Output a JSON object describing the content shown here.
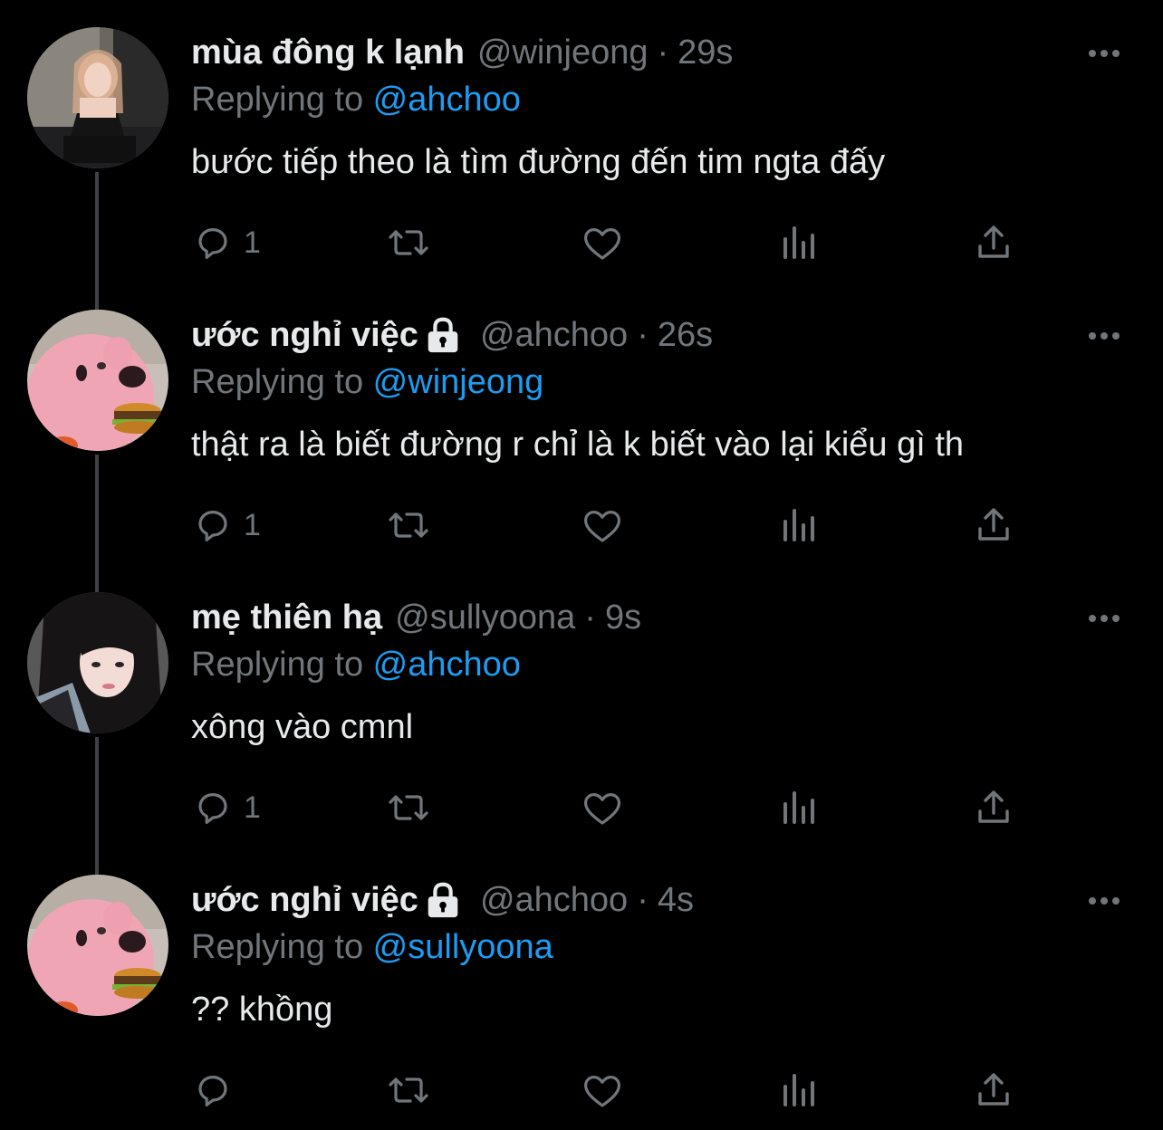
{
  "colors": {
    "background": "#000000",
    "text_primary": "#e7e9ea",
    "text_secondary": "#71767b",
    "link": "#1d9bf0",
    "thread_line": "#3e4144"
  },
  "ui": {
    "replying_prefix": "Replying to",
    "dot": "·"
  },
  "tweets": [
    {
      "display_name": "mùa đông k lạnh",
      "locked": false,
      "handle": "@winjeong",
      "time": "29s",
      "reply_to": "@ahchoo",
      "text": "bước tiếp theo là tìm đường đến tim ngta đấy",
      "reply_count": "1",
      "avatar_icon": "girl-photo-avatar"
    },
    {
      "display_name": "ước nghỉ việc",
      "locked": true,
      "handle": "@ahchoo",
      "time": "26s",
      "reply_to": "@winjeong",
      "text": "thật ra là biết đường r chỉ là k biết vào lại kiểu gì th",
      "reply_count": "1",
      "avatar_icon": "pink-beaver-burger-avatar"
    },
    {
      "display_name": "mẹ thiên hạ",
      "locked": false,
      "handle": "@sullyoona",
      "time": "9s",
      "reply_to": "@ahchoo",
      "text": "xông vào cmnl",
      "reply_count": "1",
      "avatar_icon": "girl-selfie-avatar"
    },
    {
      "display_name": "ước nghỉ việc",
      "locked": true,
      "handle": "@ahchoo",
      "time": "4s",
      "reply_to": "@sullyoona",
      "text": "?? khồng",
      "reply_count": "",
      "avatar_icon": "pink-beaver-burger-avatar"
    }
  ]
}
